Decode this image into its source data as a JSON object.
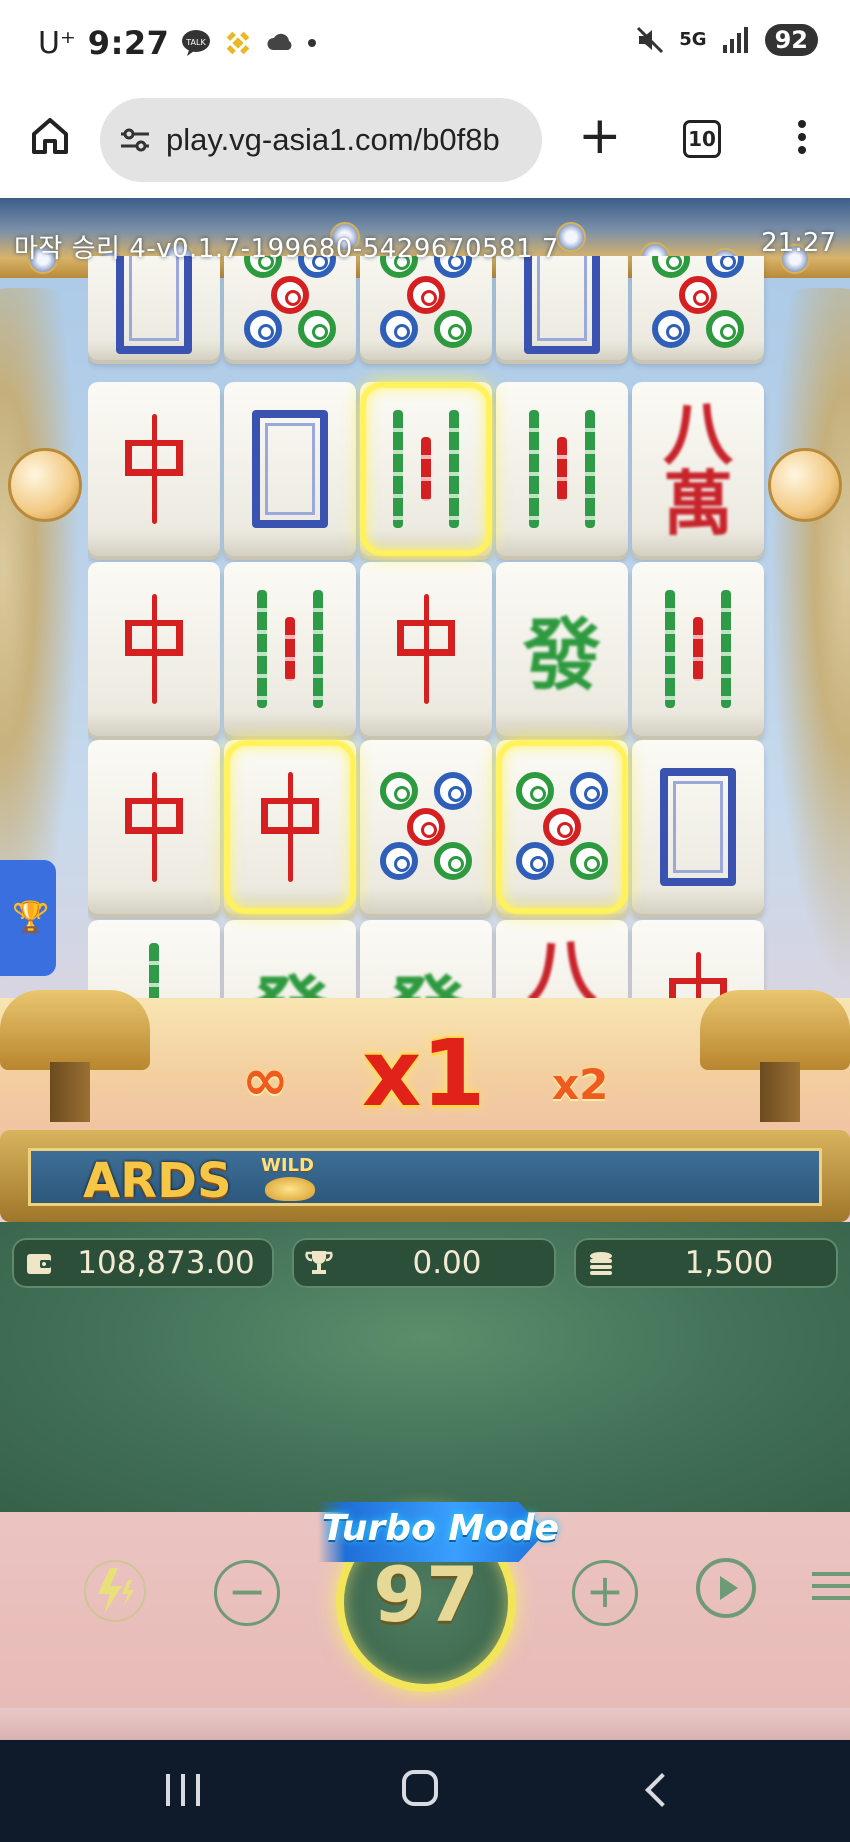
{
  "status_bar": {
    "carrier": "U⁺",
    "time": "9:27",
    "network": "5G",
    "battery": "92"
  },
  "browser": {
    "url": "play.vg-asia1.com/b0f8b",
    "tab_count": "10"
  },
  "game": {
    "header_id": "마작 승리 4-v0.1.7-199680-5429670581 7",
    "header_time": "21:27",
    "grid": [
      [
        "bai",
        "dots",
        "dots",
        "bai",
        "dots"
      ],
      [
        "zhong",
        "bai",
        "bam",
        "bam",
        "wan"
      ],
      [
        "zhong",
        "bam",
        "zhong",
        "fa",
        "bam"
      ],
      [
        "zhong",
        "zhong",
        "dots",
        "dots",
        "bai"
      ],
      [
        "bam1",
        "fa",
        "fa",
        "wan",
        "zhong"
      ]
    ],
    "multipliers": {
      "left": "∞",
      "current": "x1",
      "next": "x2"
    },
    "ticker": {
      "text": "ARDS",
      "badge": "WILD"
    },
    "stats": {
      "balance": "108,873.00",
      "win": "0.00",
      "bet": "1,500"
    },
    "controls": {
      "minus": "−",
      "plus": "+",
      "turbo_banner": "Turbo Mode",
      "spin_count": "97"
    }
  },
  "icons": {
    "talk": "talk-icon",
    "binance": "binance-icon",
    "cloud": "cloud-icon",
    "mute": "mute-icon",
    "signal": "signal-icon"
  },
  "colors": {
    "reel_highlight": "#fff25a",
    "panel_green": "#44735a",
    "ticker_blue": "#2d587c",
    "multiplier_red": "#e1221b"
  }
}
